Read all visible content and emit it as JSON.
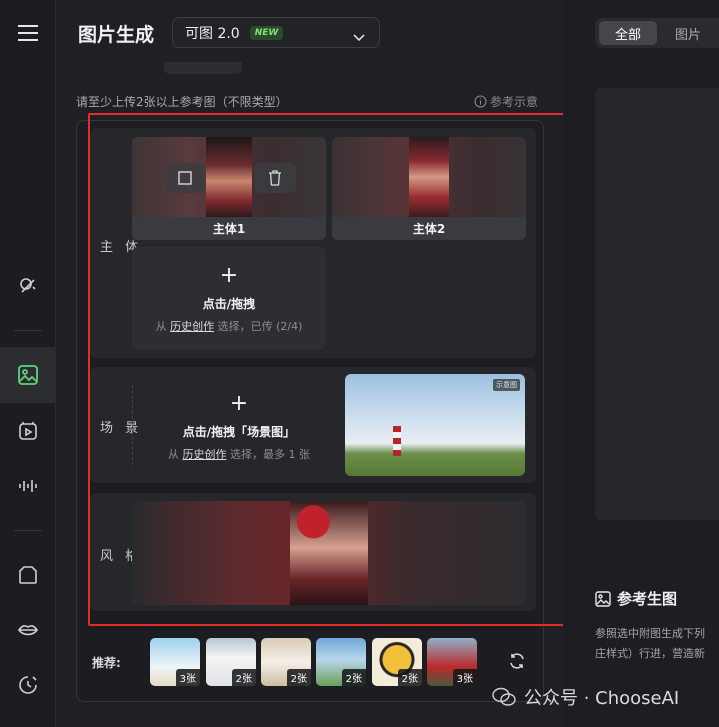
{
  "header": {
    "title": "图片生成",
    "model": "可图 2.0",
    "model_badge": "NEW"
  },
  "hint": "请至少上传2张以上参考图（不限类型）",
  "ref_demo": "参考示意",
  "subject": {
    "label": "主 体",
    "tiles": [
      "主体1",
      "主体2"
    ],
    "upload_title": "点击/拖拽",
    "upload_from": "从",
    "upload_link": "历史创作",
    "upload_suffix": "选择，已传 (2/4)"
  },
  "scene": {
    "label": "场 景",
    "upload_title": "点击/拖拽「场景图」",
    "upload_from": "从",
    "upload_link": "历史创作",
    "upload_suffix": "选择，最多 1 张",
    "image_tag": "示意图"
  },
  "style": {
    "label": "风 格"
  },
  "recommend": {
    "label": "推荐:",
    "items": [
      {
        "count": "3张"
      },
      {
        "count": "2张"
      },
      {
        "count": "2张"
      },
      {
        "count": "2张"
      },
      {
        "count": "2张"
      },
      {
        "count": "3张"
      }
    ]
  },
  "right": {
    "tabs": [
      "全部",
      "图片"
    ],
    "ref_title": "参考生图",
    "ref_desc_1": "参照选中附图生成下列",
    "ref_desc_2": "庄样式）行进，营造新"
  },
  "watermark": "公众号 · ChooseAI",
  "colors": {
    "accent_green": "#7be37a",
    "highlight_red": "#e52a2a"
  }
}
